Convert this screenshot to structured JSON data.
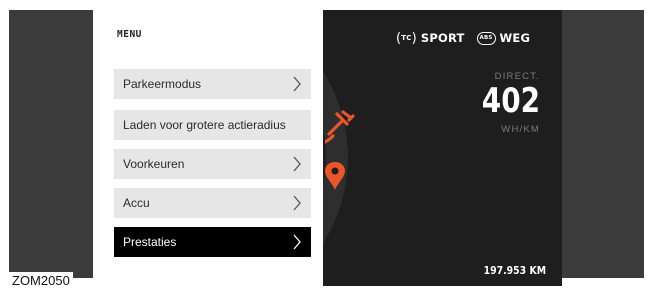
{
  "menu": {
    "title": "MENU",
    "items": [
      {
        "label": "Parkeermodus",
        "has_chevron": true,
        "selected": false
      },
      {
        "label": "Laden voor grotere actieradius",
        "has_chevron": false,
        "selected": false
      },
      {
        "label": "Voorkeuren",
        "has_chevron": true,
        "selected": false
      },
      {
        "label": "Accu",
        "has_chevron": true,
        "selected": false
      },
      {
        "label": "Prestaties",
        "has_chevron": true,
        "selected": true
      }
    ]
  },
  "status": {
    "tc_badge": "TC",
    "drive_mode": "SPORT",
    "abs_badge": "ABS",
    "road_mode": "WEG"
  },
  "consumption": {
    "label": "DIRECT.",
    "value": "402",
    "unit": "WH/KM"
  },
  "odometer": "197.953 KM",
  "figure_code": "ZOM2050",
  "icons": {
    "charge": "charge-plug-icon",
    "location": "location-pin-icon",
    "chevron": "chevron-right-icon"
  },
  "colors": {
    "accent": "#e8562a",
    "display_bg": "#1e1e1e",
    "menu_item_bg": "#e6e6e6",
    "menu_selected_bg": "#000000"
  }
}
